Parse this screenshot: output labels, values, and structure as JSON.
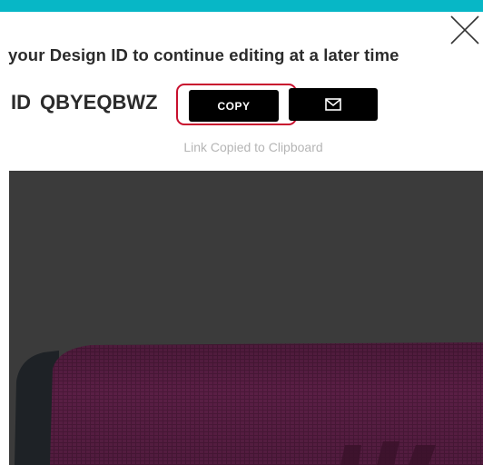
{
  "header": {
    "accent_color": "#07b7c6"
  },
  "close": {
    "icon": "close-icon"
  },
  "instruction": {
    "text": "your Design ID to continue editing at a later time"
  },
  "design_id": {
    "prefix": "ID",
    "value": "QBYEQBWZ"
  },
  "actions": {
    "copy_label": "COPY",
    "email_icon": "envelope-icon",
    "highlight_color": "#c8102e"
  },
  "status": {
    "copied_message": "Link Copied to Clipboard"
  },
  "preview": {
    "product_color": "#4a1838",
    "background_color": "#3b3b3b"
  }
}
